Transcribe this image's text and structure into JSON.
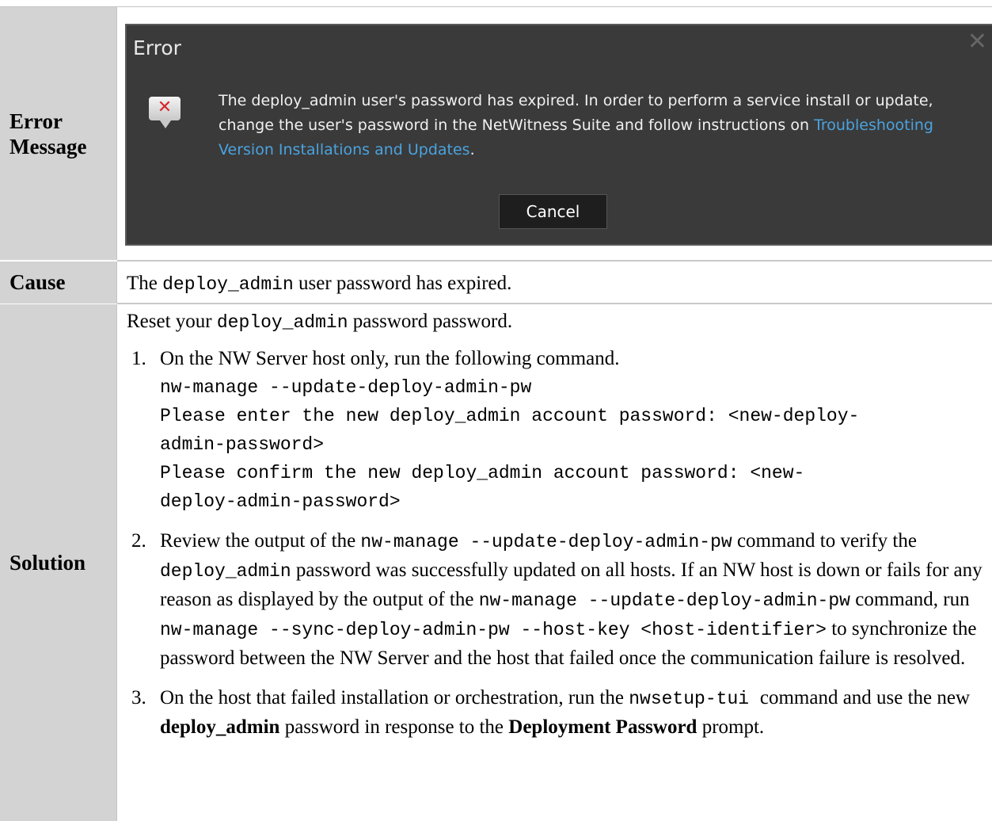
{
  "rows": {
    "error_message": {
      "label": "Error Message"
    },
    "cause": {
      "label": "Cause",
      "text_before": "The ",
      "code": "deploy_admin",
      "text_after": " user password has expired."
    },
    "solution": {
      "label": "Solution",
      "intro_before": "Reset your ",
      "intro_code": "deploy_admin",
      "intro_after": " password password.",
      "steps": [
        {
          "num": "1.",
          "text": "On the NW Server host only, run the following command.",
          "code_lines": [
            "nw-manage --update-deploy-admin-pw",
            "Please enter the new deploy_admin account password: <new-deploy-",
            "admin-password>",
            "Please confirm the new deploy_admin account password: <new-",
            "deploy-admin-password>"
          ]
        },
        {
          "num": "2.",
          "t1": "Review the output of the ",
          "c1": "nw-manage --update-deploy-admin-pw",
          "t2": " command to verify the ",
          "c2": "deploy_admin",
          "t3": " password was successfully updated on all hosts. If an NW host is down or fails for any reason as displayed by the output of the ",
          "c3": "nw-manage --update-deploy-admin-pw",
          "t4": " command, run ",
          "c4": "nw-manage --sync-deploy-admin-pw --host-key <host-identifier>",
          "t5": " to synchronize the password between the NW Server and the host that failed once the communication failure is resolved."
        },
        {
          "num": "3.",
          "t1": "On the host that failed installation or orchestration, run the ",
          "c1": "nwsetup-tui ",
          "t2": " command and use the new ",
          "b1": "deploy_admin",
          "t3": " password in response to the ",
          "b2": "Deployment Password",
          "t4": " prompt."
        }
      ]
    }
  },
  "dialog": {
    "title": "Error",
    "close_glyph": "✕",
    "icon_glyph": "✕",
    "message": "The deploy_admin user's password has expired. In order to perform a service install or update, change the user's password in the NetWitness Suite and follow instructions on ",
    "link": "Troubleshooting Version Installations and Updates",
    "message_end": ".",
    "cancel_label": "Cancel"
  }
}
